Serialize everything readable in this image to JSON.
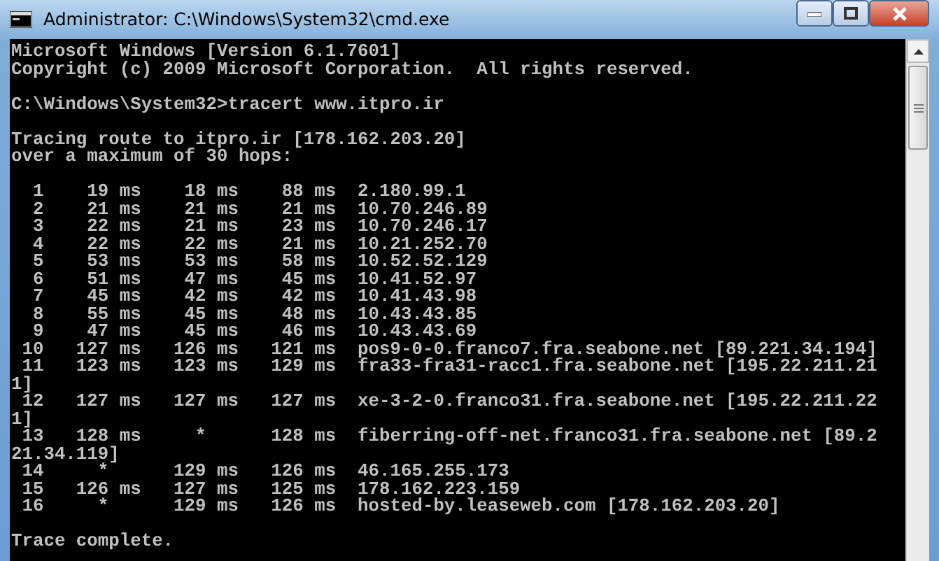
{
  "window": {
    "title": "Administrator: C:\\Windows\\System32\\cmd.exe"
  },
  "console": {
    "lines": [
      {
        "kind": "text",
        "text": "Microsoft Windows [Version 6.1.7601]"
      },
      {
        "kind": "text",
        "text": "Copyright (c) 2009 Microsoft Corporation.  All rights reserved."
      },
      {
        "kind": "blank"
      },
      {
        "kind": "text",
        "text": "C:\\Windows\\System32>tracert www.itpro.ir"
      },
      {
        "kind": "blank"
      },
      {
        "kind": "text",
        "text": "Tracing route to itpro.ir [178.162.203.20]"
      },
      {
        "kind": "text",
        "text": "over a maximum of 30 hops:"
      },
      {
        "kind": "blank"
      },
      {
        "kind": "text",
        "text": "  1    19 ms    18 ms    88 ms  2.180.99.1"
      },
      {
        "kind": "text",
        "text": "  2    21 ms    21 ms    21 ms  10.70.246.89"
      },
      {
        "kind": "text",
        "text": "  3    22 ms    21 ms    23 ms  10.70.246.17"
      },
      {
        "kind": "text",
        "text": "  4    22 ms    22 ms    21 ms  10.21.252.70"
      },
      {
        "kind": "text",
        "text": "  5    53 ms    53 ms    58 ms  10.52.52.129"
      },
      {
        "kind": "text",
        "text": "  6    51 ms    47 ms    45 ms  10.41.52.97"
      },
      {
        "kind": "text",
        "text": "  7    45 ms    42 ms    42 ms  10.41.43.98"
      },
      {
        "kind": "text",
        "text": "  8    55 ms    45 ms    48 ms  10.43.43.85"
      },
      {
        "kind": "text",
        "text": "  9    47 ms    45 ms    46 ms  10.43.43.69"
      },
      {
        "kind": "text",
        "text": " 10   127 ms   126 ms   121 ms  pos9-0-0.franco7.fra.seabone.net [89.221.34.194]"
      },
      {
        "kind": "text",
        "text": " 11   123 ms   123 ms   129 ms  fra33-fra31-racc1.fra.seabone.net [195.22.211.21"
      },
      {
        "kind": "text",
        "text": "1]"
      },
      {
        "kind": "text",
        "text": " 12   127 ms   127 ms   127 ms  xe-3-2-0.franco31.fra.seabone.net [195.22.211.22"
      },
      {
        "kind": "text",
        "text": "1]"
      },
      {
        "kind": "text",
        "text": " 13   128 ms     *      128 ms  fiberring-off-net.franco31.fra.seabone.net [89.2"
      },
      {
        "kind": "text",
        "text": "21.34.119]"
      },
      {
        "kind": "text",
        "text": " 14     *      129 ms   126 ms  46.165.255.173"
      },
      {
        "kind": "text",
        "text": " 15   126 ms   127 ms   125 ms  178.162.223.159"
      },
      {
        "kind": "text",
        "text": " 16     *      129 ms   126 ms  hosted-by.leaseweb.com [178.162.203.20]"
      },
      {
        "kind": "blank"
      },
      {
        "kind": "text",
        "text": "Trace complete."
      }
    ]
  }
}
